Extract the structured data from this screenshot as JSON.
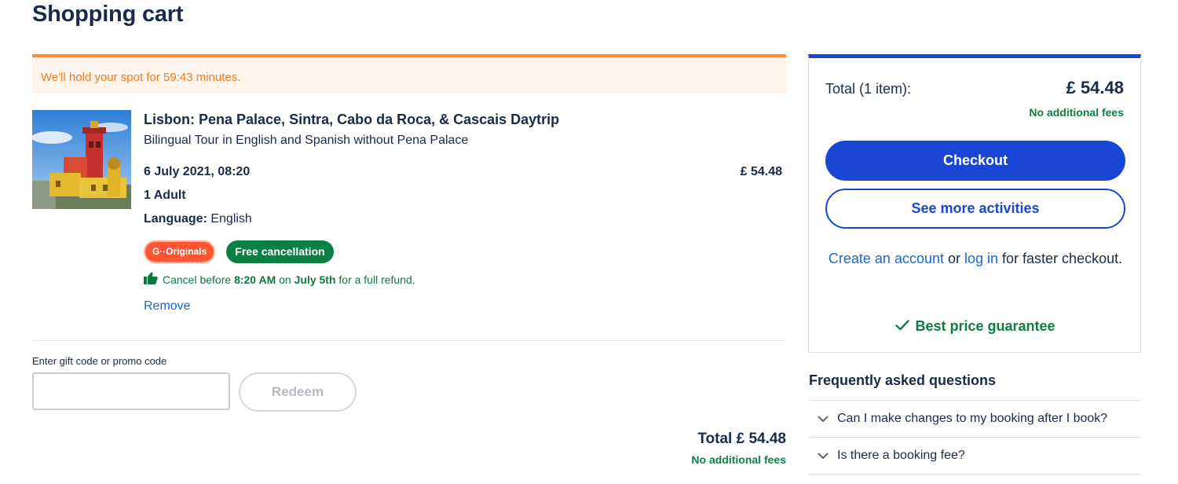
{
  "page": {
    "title": "Shopping cart"
  },
  "hold_banner": {
    "prefix": "We'll hold your spot for ",
    "time": "59:43",
    "suffix": " minutes."
  },
  "item": {
    "title": "Lisbon: Pena Palace, Sintra, Cabo da Roca, & Cascais Daytrip",
    "subtitle": "Bilingual Tour in English and Spanish without Pena Palace",
    "date": "6 July 2021, 08:20",
    "price": "£ 54.48",
    "participants": "1 Adult",
    "language_label": "Language:",
    "language_value": "English",
    "badges": {
      "originals": "G··Originals",
      "free_cancellation": "Free cancellation"
    },
    "cancel_note": {
      "prefix": "Cancel before ",
      "deadline": "8:20 AM",
      "middle": " on ",
      "date": "July 5th",
      "suffix": " for a full refund."
    },
    "remove_label": "Remove"
  },
  "promo": {
    "label": "Enter gift code or promo code",
    "input_value": "",
    "placeholder": "",
    "redeem_label": "Redeem"
  },
  "bottom_total": {
    "label": "Total",
    "value": "£ 54.48",
    "fees_note": "No additional fees"
  },
  "summary": {
    "total_label": "Total (1 item):",
    "total_value": "£ 54.48",
    "fees_note": "No additional fees",
    "checkout_label": "Checkout",
    "more_activities_label": "See more activities",
    "account": {
      "create_link": "Create an account",
      "or": " or ",
      "login_link": "log in",
      "suffix": " for faster checkout."
    },
    "best_price": "Best price guarantee"
  },
  "faq": {
    "title": "Frequently asked questions",
    "items": [
      {
        "question": "Can I make changes to my booking after I book?"
      },
      {
        "question": "Is there a booking fee?"
      }
    ]
  },
  "colors": {
    "brand_blue": "#1a46d6",
    "link_blue": "#1a68d1",
    "success_green": "#0a8045",
    "warning_orange": "#ff8d2e",
    "originals_red": "#ff5533"
  },
  "icons": {
    "thumbs_up": "thumbs-up-icon",
    "check": "check-icon",
    "chevron": "chevron-down-icon"
  }
}
